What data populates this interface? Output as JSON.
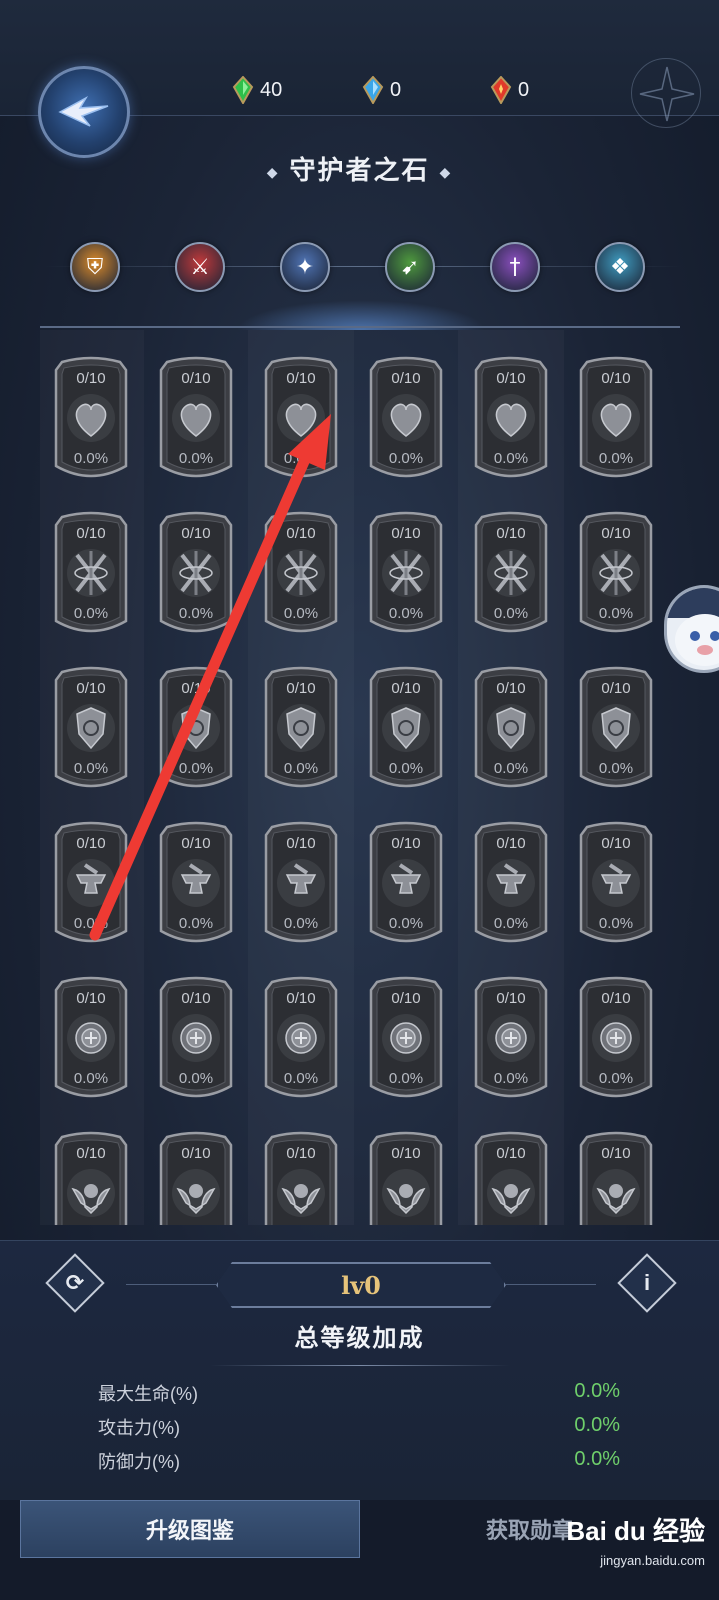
{
  "currencies": [
    {
      "name": "green-gem",
      "value": "40",
      "color": "#2fbf4a"
    },
    {
      "name": "blue-gem",
      "value": "0",
      "color": "#3aa6e8"
    },
    {
      "name": "red-gem",
      "value": "0",
      "color": "#e03a2a"
    }
  ],
  "title": "守护者之石",
  "class_icons": [
    {
      "name": "shield-class-icon",
      "color": "#d98a2b"
    },
    {
      "name": "axe-class-icon",
      "color": "#c0393a"
    },
    {
      "name": "rune-class-icon",
      "color": "#4f73b3"
    },
    {
      "name": "bow-class-icon",
      "color": "#4f9a3e"
    },
    {
      "name": "dagger-class-icon",
      "color": "#8a4fbd"
    },
    {
      "name": "wings-class-icon",
      "color": "#3f9bbf"
    }
  ],
  "grid": {
    "rows": [
      {
        "icon": "heart-icon"
      },
      {
        "icon": "crossed-swords-icon"
      },
      {
        "icon": "shield-crest-icon"
      },
      {
        "icon": "anvil-icon"
      },
      {
        "icon": "target-icon"
      },
      {
        "icon": "winged-crest-icon"
      }
    ],
    "columns": 6,
    "level_text": "0/10",
    "percent_text": "0.0%"
  },
  "level_plate": "lv0",
  "bonus_title": "总等级加成",
  "stats": [
    {
      "label": "最大生命(%)",
      "value": "0.0%"
    },
    {
      "label": "攻击力(%)",
      "value": "0.0%"
    },
    {
      "label": "防御力(%)",
      "value": "0.0%"
    }
  ],
  "tabs": {
    "active": "升级图鉴",
    "inactive": "获取勋章"
  },
  "watermark": {
    "brand": "Bai du 经验",
    "url": "jingyan.baidu.com"
  },
  "annotation": {
    "color": "#ee3a33"
  }
}
